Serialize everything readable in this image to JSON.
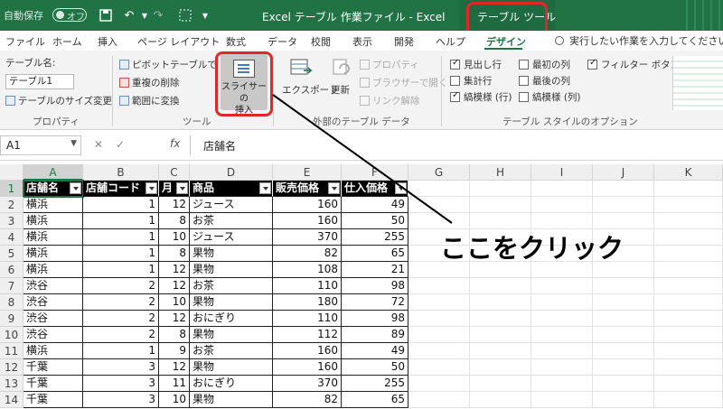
{
  "titlebar": {
    "autosave": "自動保存",
    "autosave_state": "オフ",
    "document_title": "Excel テーブル 作業ファイル  -  Excel",
    "context_title": "テーブル ツール"
  },
  "tabs": [
    "ファイル",
    "ホーム",
    "挿入",
    "ページ レイアウト",
    "数式",
    "データ",
    "校閲",
    "表示",
    "開発",
    "ヘルプ",
    "デザイン"
  ],
  "active_tab": "デザイン",
  "tell_me": "実行したい作業を入力してください",
  "ribbon": {
    "properties": {
      "table_name_label": "テーブル名:",
      "table_name_value": "テーブル1",
      "resize": "テーブルのサイズ変更",
      "group": "プロパティ"
    },
    "tools": {
      "pivot": "ピボットテーブルで集計",
      "remove_duplicates": "重複の削除",
      "convert_range": "範囲に変換",
      "slicer": "スライサーの\n挿入",
      "group": "ツール"
    },
    "external": {
      "export": "エクスポート",
      "refresh": "更新",
      "properties": "プロパティ",
      "open_browser": "ブラウザーで開く",
      "unlink": "リンク解除",
      "group": "外部のテーブル データ"
    },
    "style_options": {
      "header_row": "見出し行",
      "total_row": "集計行",
      "banded_rows": "縞模様 (行)",
      "first_col": "最初の列",
      "last_col": "最後の列",
      "banded_cols": "縞模様 (列)",
      "filter_button": "フィルター ボタン",
      "group": "テーブル スタイルのオプション",
      "checked": {
        "header_row": true,
        "total_row": false,
        "banded_rows": true,
        "first_col": false,
        "last_col": false,
        "banded_cols": false,
        "filter_button": true
      }
    }
  },
  "formula_bar": {
    "cell_ref": "A1",
    "fx": "fx",
    "content": "店舗名"
  },
  "grid": {
    "columns": [
      "A",
      "B",
      "C",
      "D",
      "E",
      "F",
      "G",
      "H",
      "I",
      "J",
      "K"
    ],
    "header": [
      "店舗名",
      "店舗コード",
      "月",
      "商品",
      "販売価格",
      "仕入価格"
    ],
    "rows": [
      [
        "横浜",
        "1",
        "12",
        "ジュース",
        "160",
        "49"
      ],
      [
        "横浜",
        "1",
        "8",
        "お茶",
        "160",
        "50"
      ],
      [
        "横浜",
        "1",
        "10",
        "ジュース",
        "370",
        "255"
      ],
      [
        "横浜",
        "1",
        "8",
        "果物",
        "82",
        "65"
      ],
      [
        "横浜",
        "1",
        "12",
        "果物",
        "108",
        "21"
      ],
      [
        "渋谷",
        "2",
        "12",
        "お茶",
        "110",
        "98"
      ],
      [
        "渋谷",
        "2",
        "10",
        "果物",
        "180",
        "72"
      ],
      [
        "渋谷",
        "2",
        "12",
        "おにぎり",
        "110",
        "98"
      ],
      [
        "渋谷",
        "2",
        "8",
        "果物",
        "112",
        "89"
      ],
      [
        "横浜",
        "1",
        "9",
        "お茶",
        "160",
        "49"
      ],
      [
        "千葉",
        "3",
        "12",
        "果物",
        "160",
        "50"
      ],
      [
        "千葉",
        "3",
        "11",
        "おにぎり",
        "370",
        "255"
      ],
      [
        "千葉",
        "3",
        "10",
        "果物",
        "82",
        "65"
      ]
    ]
  },
  "annotation": "ここをクリック",
  "colors": {
    "excel_green": "#217346",
    "highlight_red": "#e0282a"
  }
}
